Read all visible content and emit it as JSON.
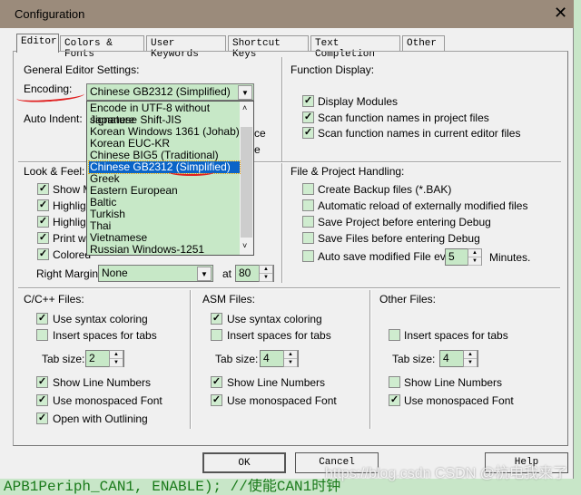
{
  "window": {
    "title": "Configuration",
    "close_icon": "close-icon"
  },
  "tabs": [
    "Editor",
    "Colors & Fonts",
    "User Keywords",
    "Shortcut Keys",
    "Text Completion",
    "Other"
  ],
  "general": {
    "heading": "General Editor Settings:",
    "encoding_label": "Encoding:",
    "encoding_value": "Chinese GB2312 (Simplified)",
    "encoding_options": [
      "Encode in UTF-8 without signature",
      "Japanese Shift-JIS",
      "Korean Windows 1361 (Johab)",
      "Korean EUC-KR",
      "Chinese BIG5 (Traditional)",
      "Chinese GB2312 (Simplified)",
      "Greek",
      "Eastern European",
      "Baltic",
      "Turkish",
      "Thai",
      "Vietnamese",
      "Russian Windows-1251"
    ],
    "auto_indent_label": "Auto Indent:",
    "hidden_fragments": [
      "ce",
      "e"
    ]
  },
  "look": {
    "heading": "Look & Feel:",
    "items": [
      {
        "label": "Show M",
        "checked": true
      },
      {
        "label": "Highligh",
        "checked": true
      },
      {
        "label": "Highligh",
        "checked": true
      },
      {
        "label": "Print wit",
        "checked": true
      },
      {
        "label": "Colored",
        "checked": true
      }
    ],
    "right_margin_label": "Right Margin:",
    "right_margin_value": "None",
    "at_label": "at",
    "at_value": "80"
  },
  "function_display": {
    "heading": "Function Display:",
    "items": [
      {
        "label": "Display Modules",
        "checked": true
      },
      {
        "label": "Scan function names in project files",
        "checked": true
      },
      {
        "label": "Scan function names in current editor files",
        "checked": true
      }
    ]
  },
  "file_project": {
    "heading": "File & Project Handling:",
    "items": [
      {
        "label": "Create Backup files (*.BAK)",
        "checked": false
      },
      {
        "label": "Automatic reload of externally modified files",
        "checked": false
      },
      {
        "label": "Save Project before entering Debug",
        "checked": false
      },
      {
        "label": "Save Files before entering Debug",
        "checked": false
      },
      {
        "label": "Auto save modified File every",
        "checked": false
      }
    ],
    "autosave_value": "5",
    "minutes_label": "Minutes."
  },
  "cpp": {
    "heading": "C/C++ Files:",
    "syntax": "Use syntax coloring",
    "spaces": "Insert spaces for tabs",
    "tab_label": "Tab size:",
    "tab_value": "2",
    "line_numbers": "Show Line Numbers",
    "mono": "Use monospaced Font",
    "outlining": "Open with Outlining"
  },
  "asm": {
    "heading": "ASM Files:",
    "syntax": "Use syntax coloring",
    "spaces": "Insert spaces for tabs",
    "tab_label": "Tab size:",
    "tab_value": "4",
    "line_numbers": "Show Line Numbers",
    "mono": "Use monospaced Font"
  },
  "other": {
    "heading": "Other Files:",
    "spaces": "Insert spaces for tabs",
    "tab_label": "Tab size:",
    "tab_value": "4",
    "line_numbers": "Show Line Numbers",
    "mono": "Use monospaced Font"
  },
  "buttons": {
    "ok": "OK",
    "cancel": "Cancel",
    "help": "Help"
  },
  "background_code": "APB1Periph_CAN1, ENABLE); //使能CAN1时钟",
  "watermark": "https://blog.csdn CSDN @杭电我来了",
  "colors": {
    "title_bar": "#9b8b7b",
    "field": "#c7e8c7",
    "selection": "#0a64c8",
    "annotation": "#e02020"
  }
}
